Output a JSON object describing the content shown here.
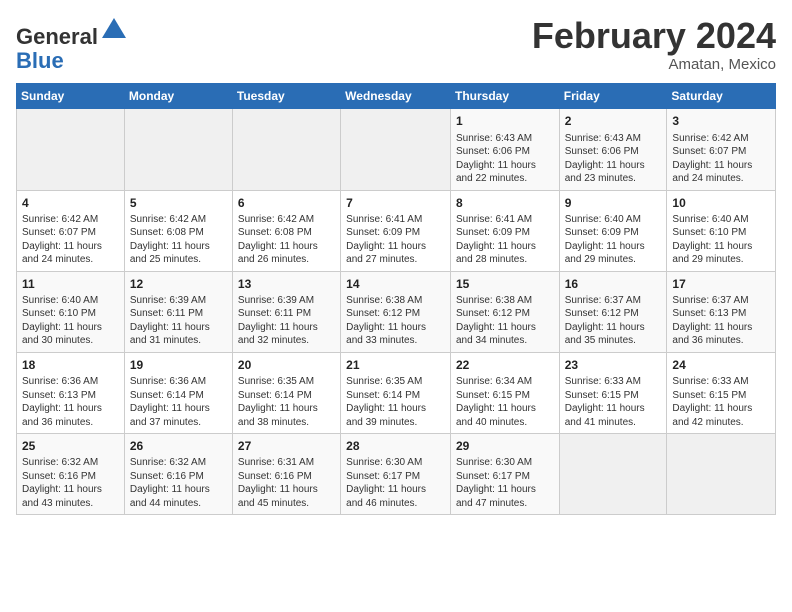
{
  "header": {
    "logo_line1": "General",
    "logo_line2": "Blue",
    "title": "February 2024",
    "subtitle": "Amatan, Mexico"
  },
  "weekdays": [
    "Sunday",
    "Monday",
    "Tuesday",
    "Wednesday",
    "Thursday",
    "Friday",
    "Saturday"
  ],
  "weeks": [
    [
      {
        "day": "",
        "info": ""
      },
      {
        "day": "",
        "info": ""
      },
      {
        "day": "",
        "info": ""
      },
      {
        "day": "",
        "info": ""
      },
      {
        "day": "1",
        "info": "Sunrise: 6:43 AM\nSunset: 6:06 PM\nDaylight: 11 hours and 22 minutes."
      },
      {
        "day": "2",
        "info": "Sunrise: 6:43 AM\nSunset: 6:06 PM\nDaylight: 11 hours and 23 minutes."
      },
      {
        "day": "3",
        "info": "Sunrise: 6:42 AM\nSunset: 6:07 PM\nDaylight: 11 hours and 24 minutes."
      }
    ],
    [
      {
        "day": "4",
        "info": "Sunrise: 6:42 AM\nSunset: 6:07 PM\nDaylight: 11 hours and 24 minutes."
      },
      {
        "day": "5",
        "info": "Sunrise: 6:42 AM\nSunset: 6:08 PM\nDaylight: 11 hours and 25 minutes."
      },
      {
        "day": "6",
        "info": "Sunrise: 6:42 AM\nSunset: 6:08 PM\nDaylight: 11 hours and 26 minutes."
      },
      {
        "day": "7",
        "info": "Sunrise: 6:41 AM\nSunset: 6:09 PM\nDaylight: 11 hours and 27 minutes."
      },
      {
        "day": "8",
        "info": "Sunrise: 6:41 AM\nSunset: 6:09 PM\nDaylight: 11 hours and 28 minutes."
      },
      {
        "day": "9",
        "info": "Sunrise: 6:40 AM\nSunset: 6:09 PM\nDaylight: 11 hours and 29 minutes."
      },
      {
        "day": "10",
        "info": "Sunrise: 6:40 AM\nSunset: 6:10 PM\nDaylight: 11 hours and 29 minutes."
      }
    ],
    [
      {
        "day": "11",
        "info": "Sunrise: 6:40 AM\nSunset: 6:10 PM\nDaylight: 11 hours and 30 minutes."
      },
      {
        "day": "12",
        "info": "Sunrise: 6:39 AM\nSunset: 6:11 PM\nDaylight: 11 hours and 31 minutes."
      },
      {
        "day": "13",
        "info": "Sunrise: 6:39 AM\nSunset: 6:11 PM\nDaylight: 11 hours and 32 minutes."
      },
      {
        "day": "14",
        "info": "Sunrise: 6:38 AM\nSunset: 6:12 PM\nDaylight: 11 hours and 33 minutes."
      },
      {
        "day": "15",
        "info": "Sunrise: 6:38 AM\nSunset: 6:12 PM\nDaylight: 11 hours and 34 minutes."
      },
      {
        "day": "16",
        "info": "Sunrise: 6:37 AM\nSunset: 6:12 PM\nDaylight: 11 hours and 35 minutes."
      },
      {
        "day": "17",
        "info": "Sunrise: 6:37 AM\nSunset: 6:13 PM\nDaylight: 11 hours and 36 minutes."
      }
    ],
    [
      {
        "day": "18",
        "info": "Sunrise: 6:36 AM\nSunset: 6:13 PM\nDaylight: 11 hours and 36 minutes."
      },
      {
        "day": "19",
        "info": "Sunrise: 6:36 AM\nSunset: 6:14 PM\nDaylight: 11 hours and 37 minutes."
      },
      {
        "day": "20",
        "info": "Sunrise: 6:35 AM\nSunset: 6:14 PM\nDaylight: 11 hours and 38 minutes."
      },
      {
        "day": "21",
        "info": "Sunrise: 6:35 AM\nSunset: 6:14 PM\nDaylight: 11 hours and 39 minutes."
      },
      {
        "day": "22",
        "info": "Sunrise: 6:34 AM\nSunset: 6:15 PM\nDaylight: 11 hours and 40 minutes."
      },
      {
        "day": "23",
        "info": "Sunrise: 6:33 AM\nSunset: 6:15 PM\nDaylight: 11 hours and 41 minutes."
      },
      {
        "day": "24",
        "info": "Sunrise: 6:33 AM\nSunset: 6:15 PM\nDaylight: 11 hours and 42 minutes."
      }
    ],
    [
      {
        "day": "25",
        "info": "Sunrise: 6:32 AM\nSunset: 6:16 PM\nDaylight: 11 hours and 43 minutes."
      },
      {
        "day": "26",
        "info": "Sunrise: 6:32 AM\nSunset: 6:16 PM\nDaylight: 11 hours and 44 minutes."
      },
      {
        "day": "27",
        "info": "Sunrise: 6:31 AM\nSunset: 6:16 PM\nDaylight: 11 hours and 45 minutes."
      },
      {
        "day": "28",
        "info": "Sunrise: 6:30 AM\nSunset: 6:17 PM\nDaylight: 11 hours and 46 minutes."
      },
      {
        "day": "29",
        "info": "Sunrise: 6:30 AM\nSunset: 6:17 PM\nDaylight: 11 hours and 47 minutes."
      },
      {
        "day": "",
        "info": ""
      },
      {
        "day": "",
        "info": ""
      }
    ]
  ]
}
